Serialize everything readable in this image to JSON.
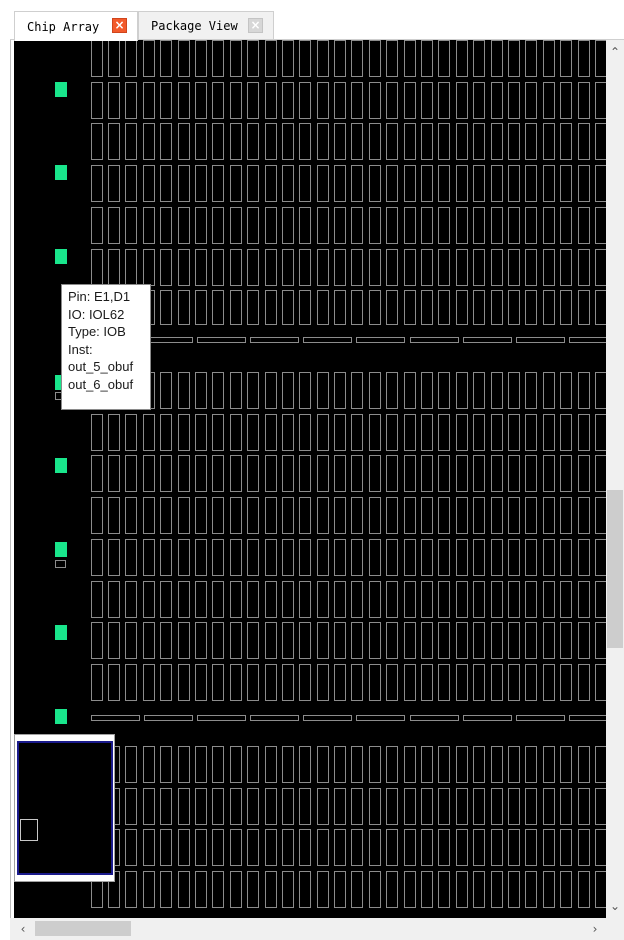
{
  "tabs": [
    {
      "label": "Chip Array",
      "active": true,
      "close_icon": "close-icon"
    },
    {
      "label": "Package View",
      "active": false,
      "close_icon": "close-icon"
    }
  ],
  "tooltip": {
    "pin": "Pin: E1,D1",
    "io": "IO: IOL62",
    "type": "Type: IOB",
    "inst_label": "Inst:",
    "inst_1": "out_5_obuf",
    "inst_2": "out_6_obuf"
  },
  "colors": {
    "canvas_bg": "#000000",
    "tile_outline": "#8c8c8c",
    "io_pad_used": "#19e68c",
    "tab_close_active": "#f25a2b",
    "minimap_border": "#1a1a8c"
  },
  "scrollbars": {
    "vertical_up_icon": "chevron-up-icon",
    "vertical_down_icon": "chevron-down-icon",
    "horizontal_left_icon": "chevron-left-icon",
    "horizontal_right_icon": "chevron-right-icon"
  }
}
